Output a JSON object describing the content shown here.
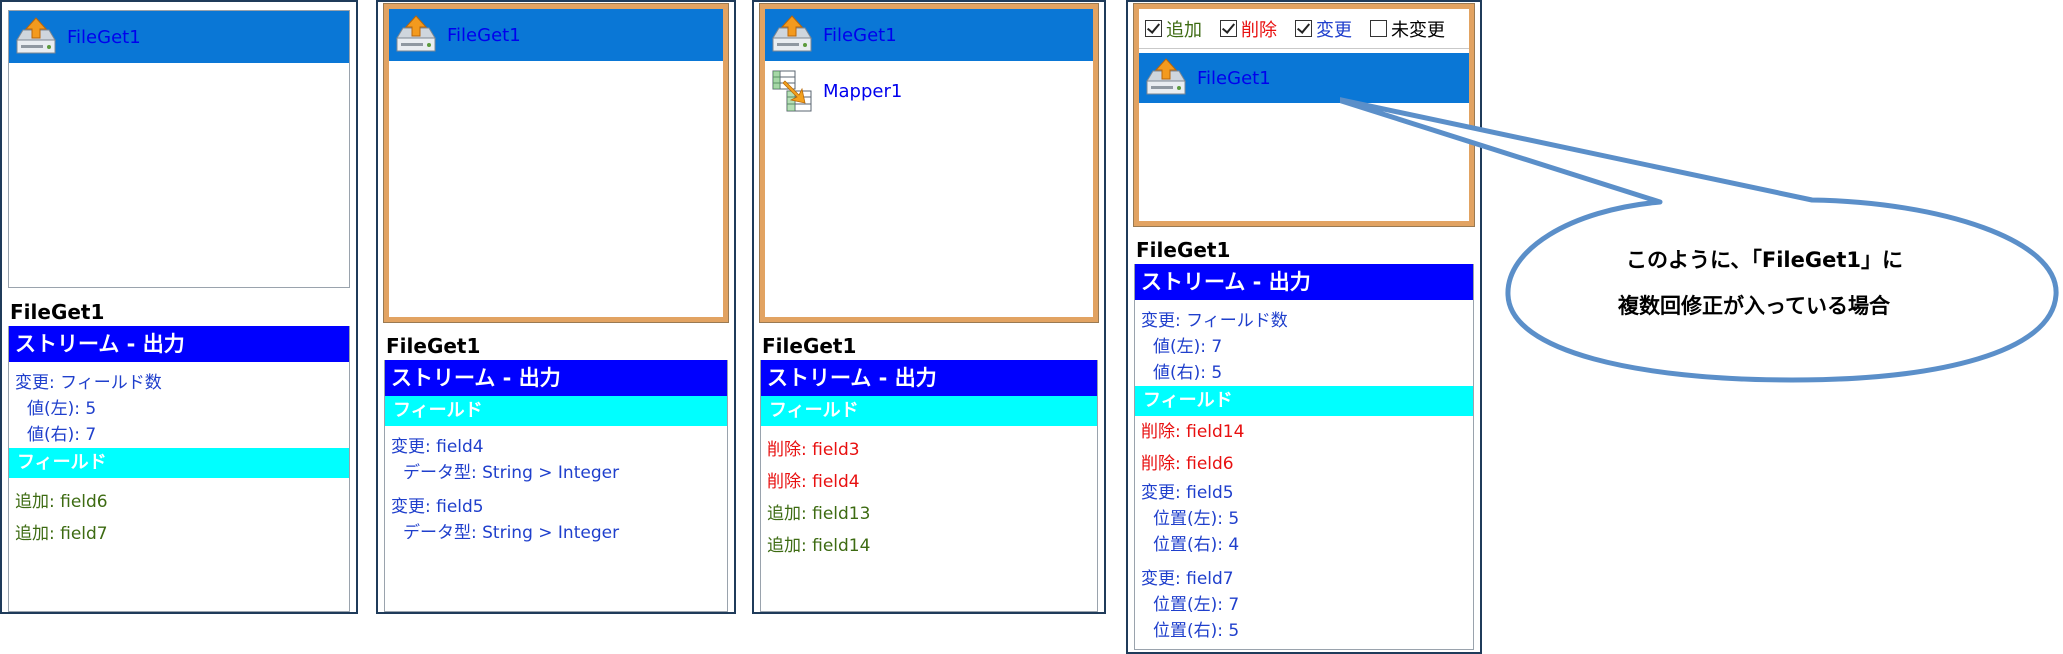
{
  "icons": {
    "fileget": "upload-disk-icon",
    "mapper": "mapper-table-icon",
    "checkbox": "checkbox-icon"
  },
  "colors": {
    "selection": "#0a77d6",
    "stream_bar": "#0000ff",
    "field_bar": "#00ffff",
    "add": "#3d6b12",
    "delete": "#e81010",
    "change": "#1f3fcc",
    "orange_frame": "#e2a362",
    "bubble_stroke": "#5b8fc9"
  },
  "panel1": {
    "node": "FileGet1",
    "title": "FileGet1",
    "stream": "ストリーム - 出力",
    "change_label": "変更: フィールド数",
    "left_value": "値(左): 5",
    "right_value": "値(右): 7",
    "field_header": "フィールド",
    "fields": [
      "追加: field6",
      "追加: field7"
    ]
  },
  "panel2": {
    "node": "FileGet1",
    "title": "FileGet1",
    "stream": "ストリーム - 出力",
    "field_header": "フィールド",
    "change1": "変更: field4",
    "change1_type": "データ型: String > Integer",
    "change2": "変更: field5",
    "change2_type": "データ型: String > Integer"
  },
  "panel3": {
    "node1": "FileGet1",
    "node2": "Mapper1",
    "title": "FileGet1",
    "stream": "ストリーム - 出力",
    "field_header": "フィールド",
    "deletes": [
      "削除: field3",
      "削除: field4"
    ],
    "adds": [
      "追加: field13",
      "追加: field14"
    ]
  },
  "panel4": {
    "checkboxes": [
      {
        "label": "追加",
        "checked": true,
        "color": "#3d6b12"
      },
      {
        "label": "削除",
        "checked": true,
        "color": "#e81010"
      },
      {
        "label": "変更",
        "checked": true,
        "color": "#1f3fcc"
      },
      {
        "label": "未変更",
        "checked": false,
        "color": "#000000"
      }
    ],
    "node": "FileGet1",
    "title": "FileGet1",
    "stream": "ストリーム - 出力",
    "change_label": "変更: フィールド数",
    "left_value": "値(左): 7",
    "right_value": "値(右): 5",
    "field_header": "フィールド",
    "deletes": [
      "削除: field14",
      "削除: field6"
    ],
    "change1": "変更: field5",
    "change1_left": "位置(左): 5",
    "change1_right": "位置(右): 4",
    "change2": "変更: field7",
    "change2_left": "位置(左): 7",
    "change2_right": "位置(右): 5"
  },
  "callout": {
    "line1": "このように、「FileGet1」に",
    "line2": "複数回修正が入っている場合"
  }
}
